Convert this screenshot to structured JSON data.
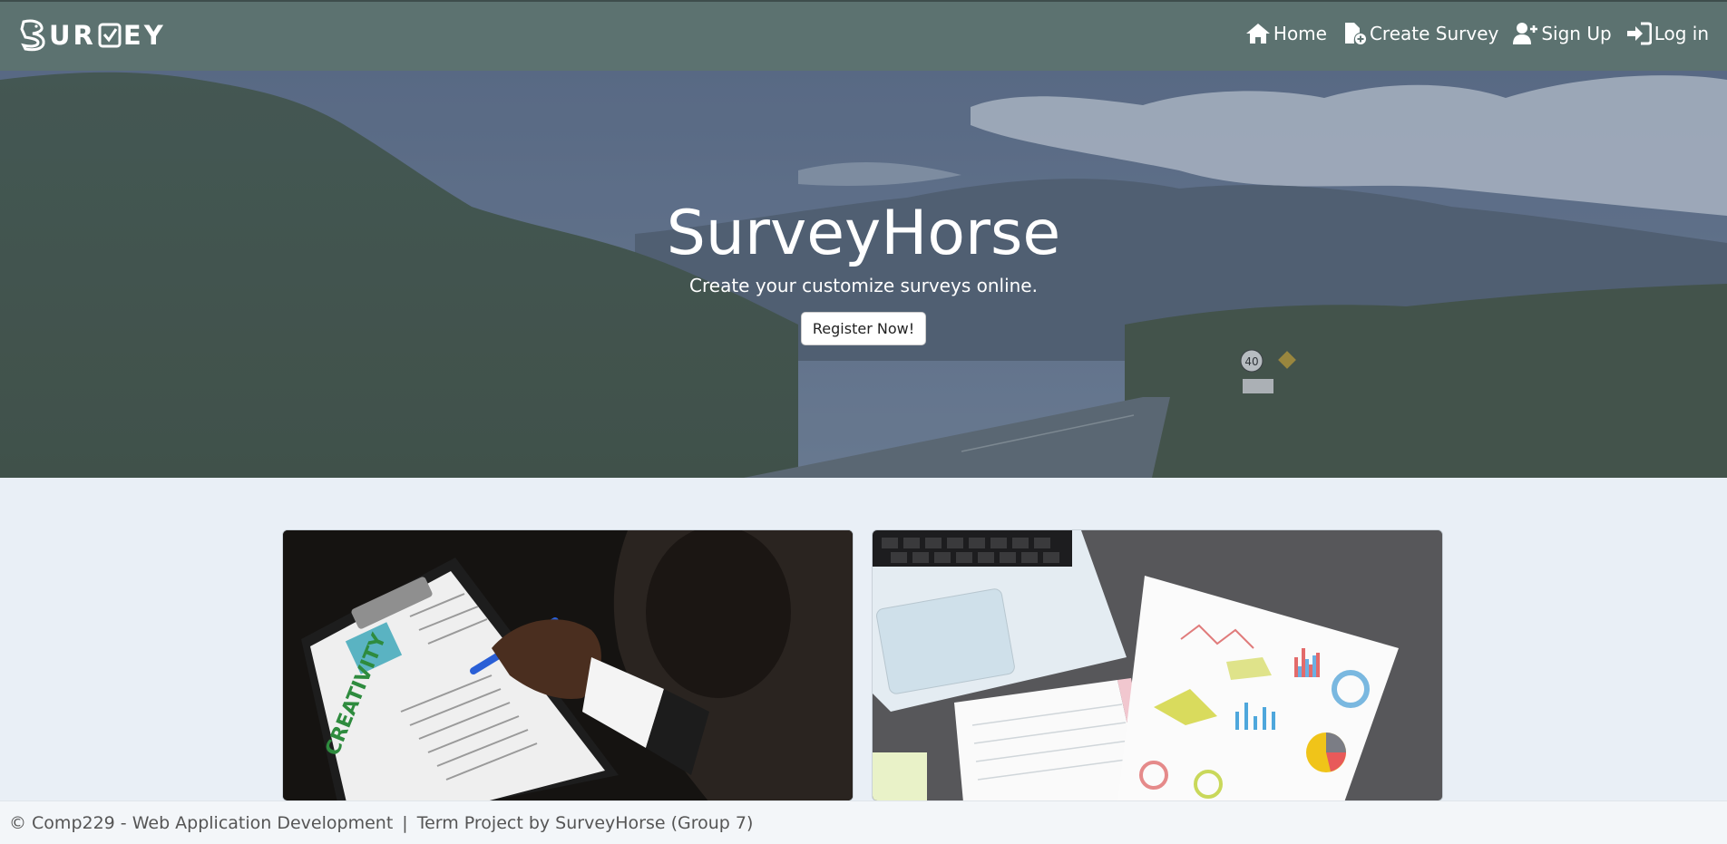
{
  "brand": {
    "logo_text": "SURVEY",
    "logo_icon": "horse-head-logo"
  },
  "nav": {
    "items": [
      {
        "label": "Home",
        "icon": "home-icon"
      },
      {
        "label": "Create Survey",
        "icon": "file-plus-icon"
      },
      {
        "label": "Sign Up",
        "icon": "user-plus-icon"
      },
      {
        "label": "Log in",
        "icon": "sign-in-icon"
      }
    ]
  },
  "hero": {
    "title": "SurveyHorse",
    "subtitle": "Create your customize surveys online.",
    "button_label": "Register Now!",
    "road_sign_number": "40"
  },
  "cards": [
    {
      "name": "creativity-survey-image"
    },
    {
      "name": "charts-laptop-image"
    }
  ],
  "footer": {
    "copyright": "© Comp229 - Web Application Development",
    "separator": "|",
    "project": "Term Project by SurveyHorse (Group 7)"
  },
  "colors": {
    "navbar": "#5c7270",
    "page_bg": "#e9eff6",
    "footer_bg": "#f3f6f9"
  }
}
